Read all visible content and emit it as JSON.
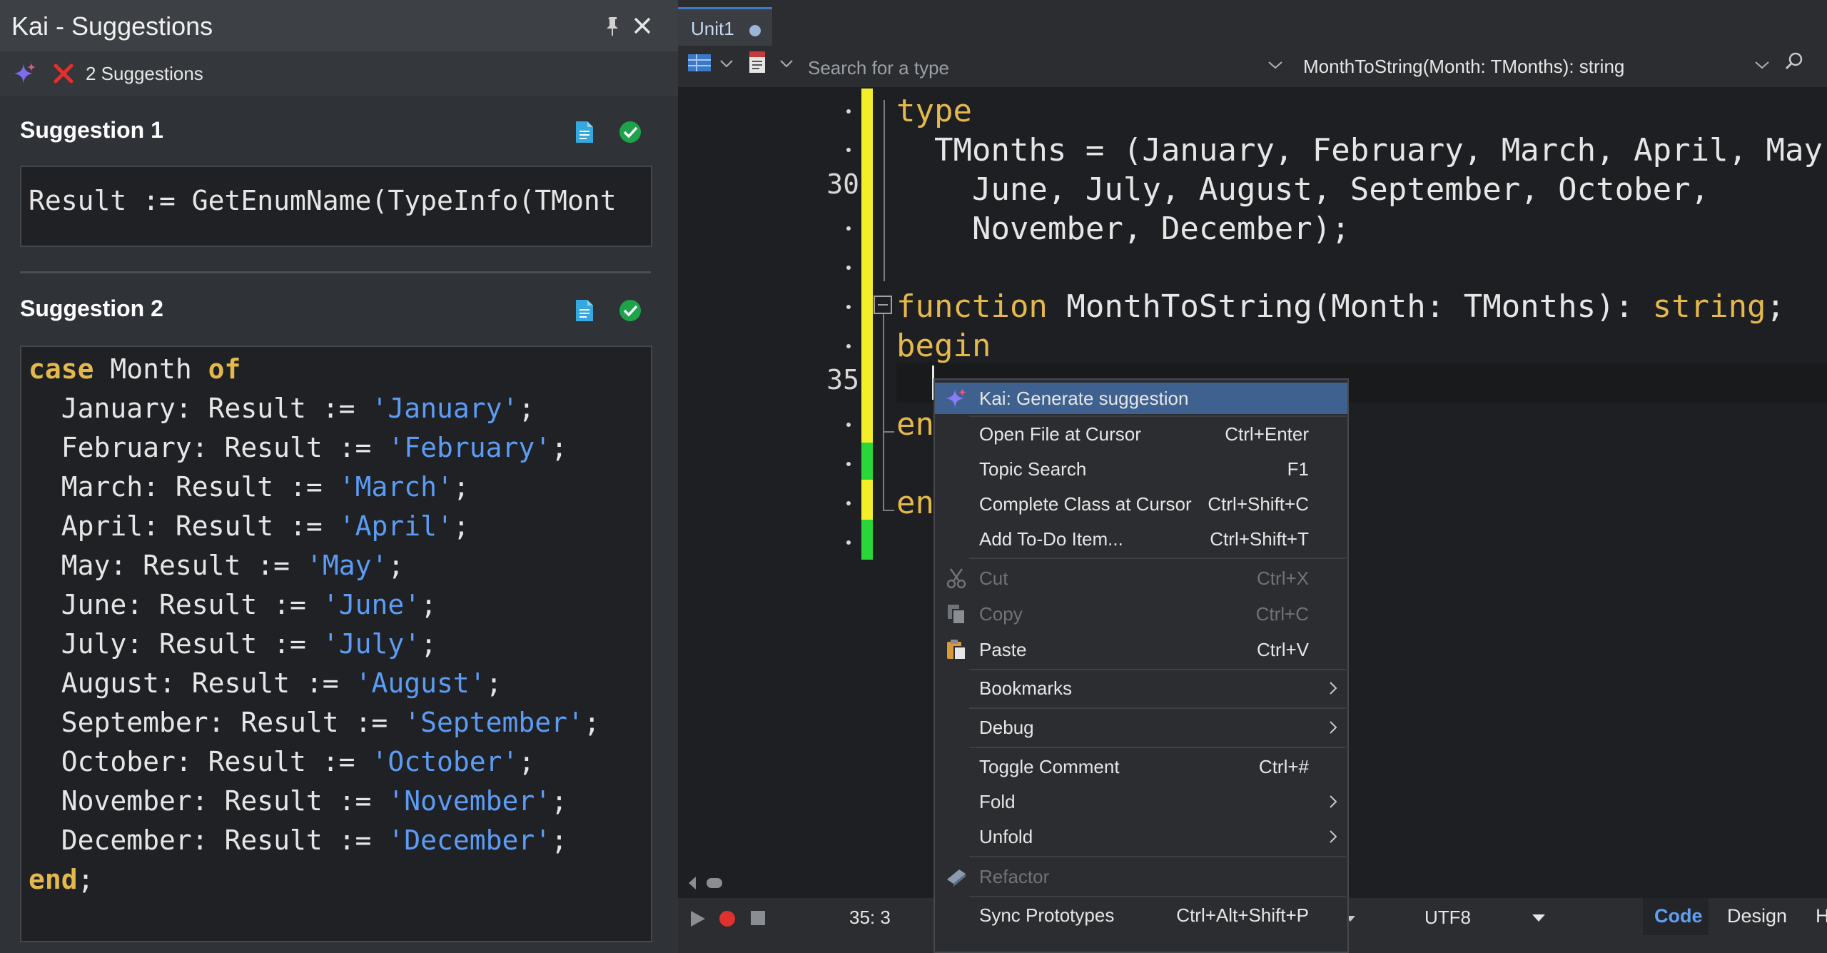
{
  "panel": {
    "title": "Kai - Suggestions",
    "count_text": "2 Suggestions",
    "suggestion1": {
      "heading": "Suggestion 1",
      "line": "Result := GetEnumName(TypeInfo(TMont"
    },
    "suggestion2": {
      "heading": "Suggestion 2",
      "lines": [
        {
          "kw1": "case",
          "text": " Month ",
          "kw2": "of"
        },
        {
          "pre": "  January: Result := ",
          "str": "'January'",
          "post": ";"
        },
        {
          "pre": "  February: Result := ",
          "str": "'February'",
          "post": ";"
        },
        {
          "pre": "  March: Result := ",
          "str": "'March'",
          "post": ";"
        },
        {
          "pre": "  April: Result := ",
          "str": "'April'",
          "post": ";"
        },
        {
          "pre": "  May: Result := ",
          "str": "'May'",
          "post": ";"
        },
        {
          "pre": "  June: Result := ",
          "str": "'June'",
          "post": ";"
        },
        {
          "pre": "  July: Result := ",
          "str": "'July'",
          "post": ";"
        },
        {
          "pre": "  August: Result := ",
          "str": "'August'",
          "post": ";"
        },
        {
          "pre": "  September: Result := ",
          "str": "'September'",
          "post": ";"
        },
        {
          "pre": "  October: Result := ",
          "str": "'October'",
          "post": ";"
        },
        {
          "pre": "  November: Result := ",
          "str": "'November'",
          "post": ";"
        },
        {
          "pre": "  December: Result := ",
          "str": "'December'",
          "post": ";"
        },
        {
          "kw1": "end",
          "text": ";"
        }
      ]
    }
  },
  "editor": {
    "tab_label": "Unit1",
    "type_search_placeholder": "Search for a type",
    "method_selected": "MonthToString(Month: TMonths): string",
    "gutter_numbers": {
      "n30": "30",
      "n35": "35"
    },
    "code": {
      "l1_kw": "type",
      "l2": "  TMonths = (January, February, March, April, May,",
      "l3": "    June, July, August, September, October,",
      "l4": "    November, December);",
      "l6_kw": "function",
      "l6_text": " MonthToString(Month: TMonths): ",
      "l6_kw2": "string",
      "l6_end": ";",
      "l7_kw": "begin",
      "l9_kw": "en",
      "l11_kw": "en"
    }
  },
  "status": {
    "cursor_pos": "35:  3",
    "encoding": "UTF8",
    "tabs": {
      "code": "Code",
      "design": "Design",
      "history": "H"
    }
  },
  "menu": {
    "kai_generate": "Kai: Generate suggestion",
    "open_file": {
      "label": "Open File at Cursor",
      "shortcut": "Ctrl+Enter"
    },
    "topic_search": {
      "label": "Topic Search",
      "shortcut": "F1"
    },
    "complete_class": {
      "label": "Complete Class at Cursor",
      "shortcut": "Ctrl+Shift+C"
    },
    "add_todo": {
      "label": "Add To-Do Item...",
      "shortcut": "Ctrl+Shift+T"
    },
    "cut": {
      "label": "Cut",
      "shortcut": "Ctrl+X"
    },
    "copy": {
      "label": "Copy",
      "shortcut": "Ctrl+C"
    },
    "paste": {
      "label": "Paste",
      "shortcut": "Ctrl+V"
    },
    "bookmarks": "Bookmarks",
    "debug": "Debug",
    "toggle_comment": {
      "label": "Toggle Comment",
      "shortcut": "Ctrl+#"
    },
    "fold": "Fold",
    "unfold": "Unfold",
    "refactor": "Refactor",
    "sync_prototypes": {
      "label": "Sync Prototypes",
      "shortcut": "Ctrl+Alt+Shift+P"
    }
  },
  "colors": {
    "keyword": "#e5b84c",
    "string": "#5c9cf5",
    "highlight": "#3f6190",
    "change_yellow": "#f2ef2a",
    "change_green": "#2bd63a"
  }
}
